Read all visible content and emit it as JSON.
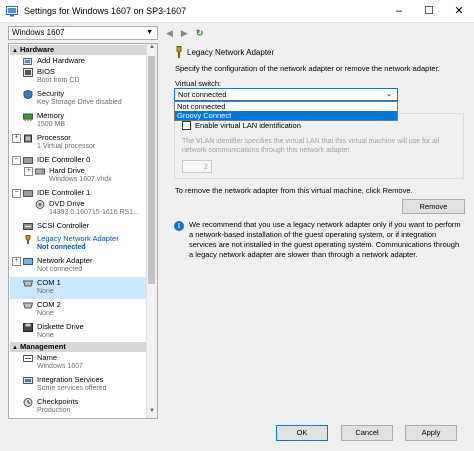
{
  "window": {
    "title": "Settings for Windows 1607 on SP3-1607"
  },
  "vm_selector": {
    "value": "Windows 1607"
  },
  "sidebar": {
    "sections": [
      {
        "label": "Hardware"
      },
      {
        "label": "Management"
      }
    ],
    "items": [
      {
        "label": "Add Hardware",
        "sub": ""
      },
      {
        "label": "BIOS",
        "sub": "Boot from CD"
      },
      {
        "label": "Security",
        "sub": "Key Storage Drive disabled"
      },
      {
        "label": "Memory",
        "sub": "1500 MB"
      },
      {
        "label": "Processor",
        "sub": "1 Virtual processor"
      },
      {
        "label": "IDE Controller 0",
        "sub": ""
      },
      {
        "label": "Hard Drive",
        "sub": "Windows 1607.vhdx"
      },
      {
        "label": "IDE Controller 1",
        "sub": ""
      },
      {
        "label": "DVD Drive",
        "sub": "14393.0.160715-1616.RS1..."
      },
      {
        "label": "SCSI Controller",
        "sub": ""
      },
      {
        "label": "Legacy Network Adapter",
        "sub": "Not connected"
      },
      {
        "label": "Network Adapter",
        "sub": "Not connected"
      },
      {
        "label": "COM 1",
        "sub": "None"
      },
      {
        "label": "COM 2",
        "sub": "None"
      },
      {
        "label": "Diskette Drive",
        "sub": "None"
      },
      {
        "label": "Name",
        "sub": "Windows 1607"
      },
      {
        "label": "Integration Services",
        "sub": "Some services offered"
      },
      {
        "label": "Checkpoints",
        "sub": "Production"
      }
    ]
  },
  "panel": {
    "title": "Legacy Network Adapter",
    "description": "Specify the configuration of the network adapter or remove the network adapter.",
    "virtual_switch_label": "Virtual switch:",
    "virtual_switch_value": "Not connected",
    "dropdown_options": [
      "Not connected",
      "Groovy Connect"
    ],
    "vlan_checkbox_label": "Enable virtual LAN identification",
    "vlan_description": "The VLAN identifier specifies the virtual LAN that this virtual machine will use for all network communications through this network adapter.",
    "vlan_value": "2",
    "remove_description": "To remove the network adapter from this virtual machine, click Remove.",
    "remove_button": "Remove",
    "info_text": "We recommend that you use a legacy network adapter only if you want to perform a network-based installation of the guest operating system, or if integration services are not installed in the guest operating system. Communications through a legacy network adapter are slower than through a network adapter."
  },
  "footer": {
    "ok": "OK",
    "cancel": "Cancel",
    "apply": "Apply"
  },
  "colors": {
    "accent": "#0078d7",
    "selection": "#cce8ff",
    "selected_text": "#0050c0"
  }
}
